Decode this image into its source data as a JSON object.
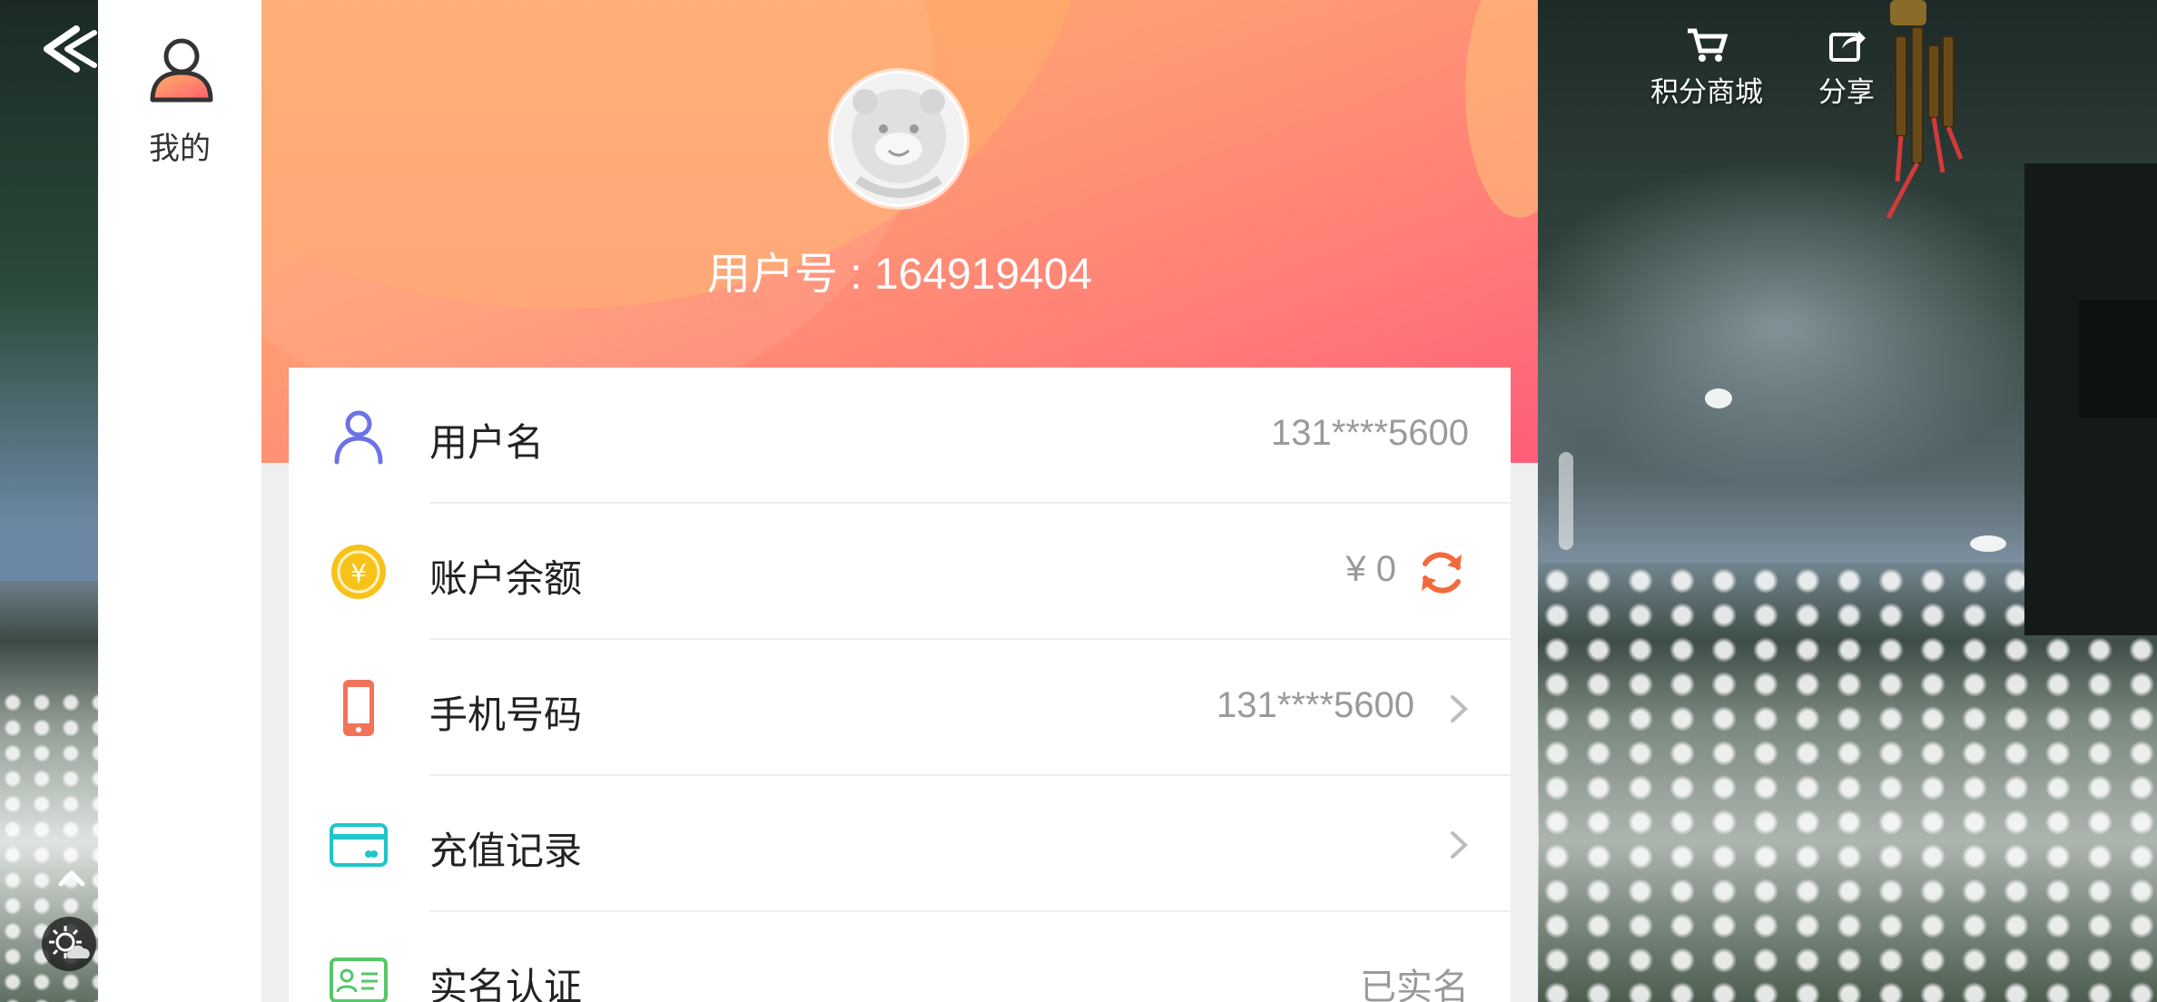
{
  "game_hud": {
    "points_mall_label": "积分商城",
    "share_label": "分享"
  },
  "side_tab": {
    "label": "我的"
  },
  "profile": {
    "user_id_text": "用户号 : 164919404"
  },
  "info_list": [
    {
      "title": "用户名",
      "value": "131****5600",
      "icon": "person-icon",
      "has_chevron": false
    },
    {
      "title": "账户余额",
      "value": "¥ 0",
      "icon": "coin-icon",
      "has_refresh": true
    },
    {
      "title": "手机号码",
      "value": "131****5600",
      "icon": "phone-icon",
      "has_chevron": true
    },
    {
      "title": "充值记录",
      "value": "",
      "icon": "card-icon",
      "has_chevron": true
    },
    {
      "title": "实名认证",
      "value": "已实名",
      "icon": "id-card-icon",
      "has_chevron": false
    }
  ],
  "colors": {
    "header_gradient_start": "#ffb06c",
    "header_gradient_end": "#ff5e78",
    "refresh_accent": "#f26a3c",
    "person_icon": "#6c72e6",
    "coin_icon": "#f7c21a",
    "phone_icon": "#f2725a",
    "card_icon": "#1ec6c9",
    "id_card_icon": "#58c66a"
  }
}
